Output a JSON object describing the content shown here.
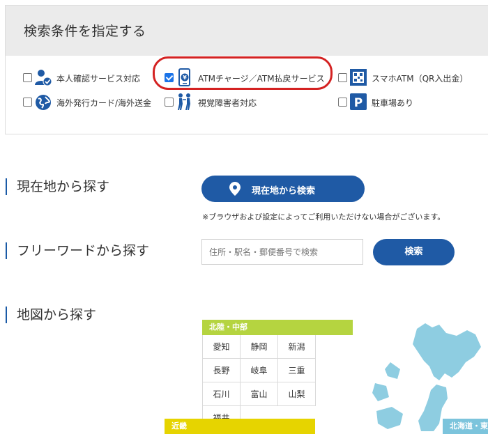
{
  "filter": {
    "title": "検索条件を指定する",
    "options": [
      {
        "label": "本人確認サービス対応",
        "checked": false,
        "icon": "person-check-icon"
      },
      {
        "label": "ATMチャージ／ATM払戻サービス",
        "checked": true,
        "icon": "phone-yen-icon"
      },
      {
        "label": "スマホATM（QR入出金）",
        "checked": false,
        "icon": "qr-atm-icon"
      },
      {
        "label": "海外発行カード/海外送金",
        "checked": false,
        "icon": "globe-icon"
      },
      {
        "label": "視覚障害者対応",
        "checked": false,
        "icon": "accessibility-icon"
      },
      {
        "label": "駐車場あり",
        "checked": false,
        "icon": "parking-icon"
      }
    ]
  },
  "location": {
    "heading": "現在地から探す",
    "button": "現在地から検索",
    "note": "※ブラウザおよび設定によってご利用いただけない場合がございます。"
  },
  "freeword": {
    "heading": "フリーワードから探す",
    "placeholder": "住所・駅名・郵便番号で検索",
    "button": "検索"
  },
  "map": {
    "heading": "地図から探す",
    "regions": [
      {
        "name": "北陸・中部",
        "color": "#b5d440",
        "prefectures": [
          "愛知",
          "静岡",
          "新潟",
          "長野",
          "岐阜",
          "三重",
          "石川",
          "富山",
          "山梨",
          "福井"
        ]
      },
      {
        "name": "近畿",
        "color": "#e6d400"
      },
      {
        "name": "北海道・東",
        "color": "#7cc4dc"
      }
    ],
    "map_color": "#8ecde1"
  }
}
